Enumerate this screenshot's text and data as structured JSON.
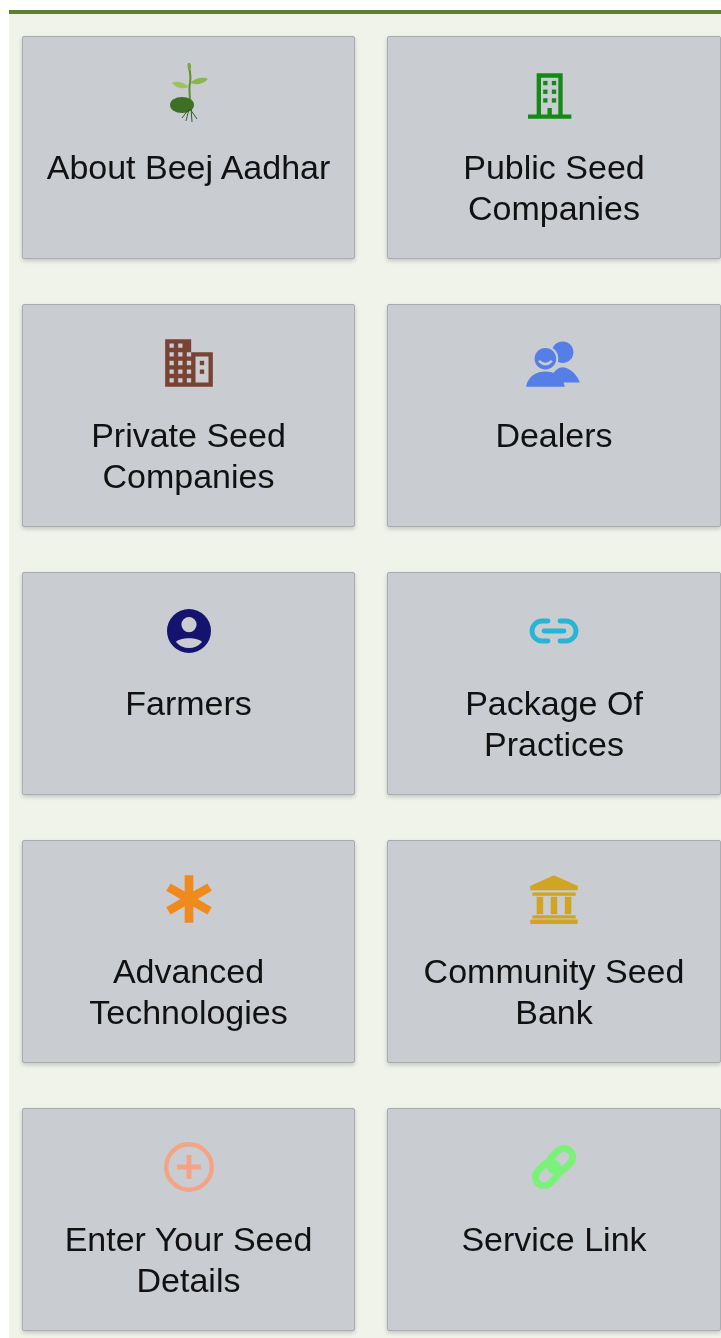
{
  "tiles": [
    {
      "label": "About Beej Aadhar",
      "kind": "sprout"
    },
    {
      "label": "Public Seed Companies",
      "kind": "building",
      "color": "#138a13"
    },
    {
      "label": "Private Seed Companies",
      "kind": "buildings",
      "color": "#7a4232"
    },
    {
      "label": "Dealers",
      "kind": "people",
      "color": "#557ee6"
    },
    {
      "label": "Farmers",
      "kind": "account",
      "color": "#14146e"
    },
    {
      "label": "Package Of Practices",
      "kind": "link",
      "color": "#27b5d6"
    },
    {
      "label": "Advanced Technologies",
      "kind": "asterisk",
      "color": "#ef8a1e"
    },
    {
      "label": "Community Seed Bank",
      "kind": "bank",
      "color": "#d2a424"
    },
    {
      "label": "Enter Your Seed Details",
      "kind": "plus",
      "color": "#f4a386"
    },
    {
      "label": "Service Link",
      "kind": "chain",
      "color": "#7af27a"
    }
  ]
}
